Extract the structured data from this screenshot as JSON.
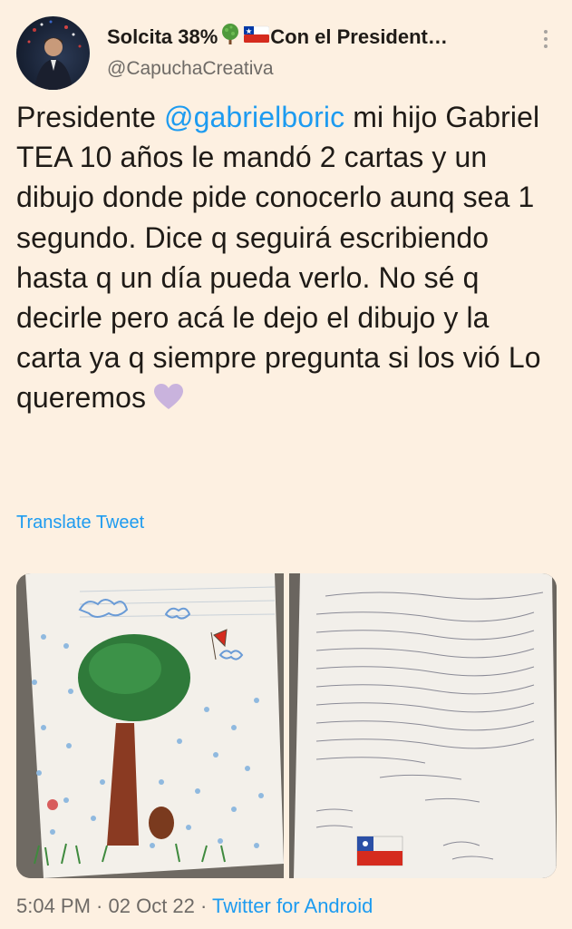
{
  "author": {
    "display_name": "Solcita 38%",
    "display_name_suffix": "Con el President…",
    "handle": "@CapuchaCreativa"
  },
  "tweet": {
    "text_before_mention": "Presidente ",
    "mention": "@gabrielboric",
    "text_after_mention": " mi hijo Gabriel TEA 10 años le mandó 2 cartas y un dibujo donde pide conocerlo aunq sea 1 segundo. Dice q seguirá escribiendo hasta q un día pueda verlo. No sé q decirle pero acá le dejo el dibujo y la carta ya q siempre pregunta si los vió Lo queremos"
  },
  "translate_label": "Translate Tweet",
  "footer": {
    "time": "5:04 PM",
    "separator": " · ",
    "date": "02 Oct 22",
    "source": "Twitter for Android"
  },
  "icons": {
    "tree_emoji": "tree-icon",
    "flag_emoji": "chile-flag-icon",
    "heart_emoji": "purple-heart-icon",
    "more": "more-options-icon"
  },
  "colors": {
    "background": "#fdf0e1",
    "link": "#1d9bf0",
    "secondary_text": "#6e6a66",
    "heart": "#c9b3dd"
  }
}
